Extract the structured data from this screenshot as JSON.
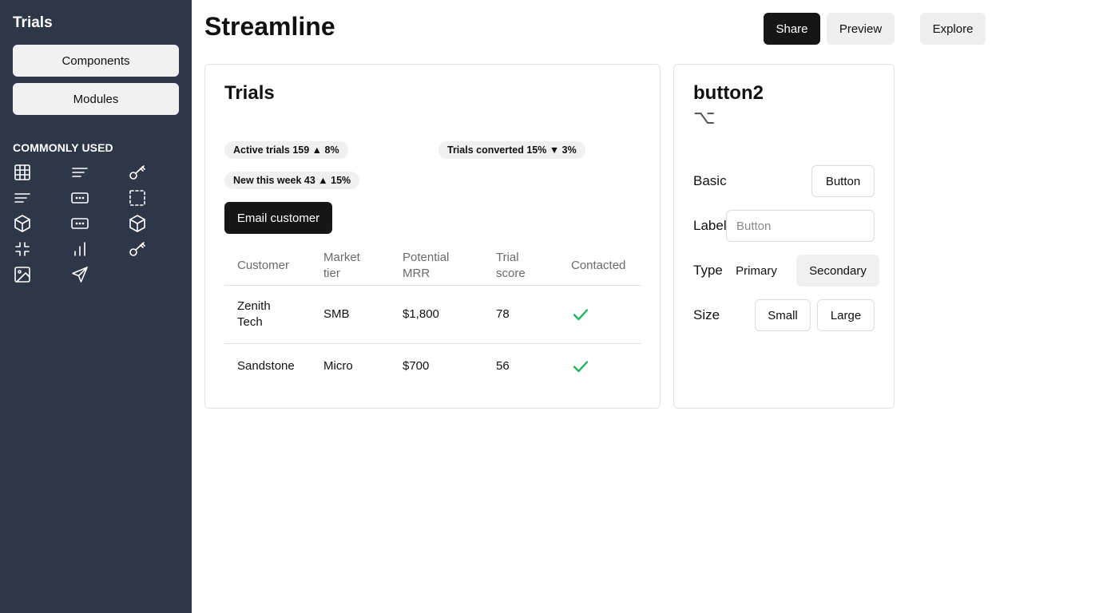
{
  "sidebar": {
    "title": "Trials",
    "buttons": [
      "Components",
      "Modules"
    ],
    "section_title": "COMMONLY USED",
    "icons": [
      "table-icon",
      "text-align-left-icon",
      "key-icon",
      "text-align-left-icon",
      "input-field-icon",
      "selection-box-icon",
      "cube-icon",
      "input-field-icon",
      "cube-icon",
      "minimize-icon",
      "bar-chart-icon",
      "key-icon",
      "image-icon",
      "send-icon"
    ]
  },
  "header": {
    "title": "Streamline",
    "share_label": "Share",
    "preview_label": "Preview",
    "explore_label": "Explore"
  },
  "trials_card": {
    "title": "Trials",
    "stats": [
      "Active trials 159 ▲ 8%",
      "Trials converted 15% ▼ 3%",
      "New this week 43 ▲ 15%"
    ],
    "email_button": "Email customer",
    "columns": [
      [
        "Customer"
      ],
      [
        "Market",
        "tier"
      ],
      [
        "Potential",
        "MRR"
      ],
      [
        "Trial",
        "score"
      ],
      [
        "Contacted"
      ]
    ],
    "rows": [
      {
        "customer": [
          "Zenith",
          "Tech"
        ],
        "tier": "SMB",
        "mrr": "$1,800",
        "score": "78",
        "contacted": true
      },
      {
        "customer": [
          "Sandstone"
        ],
        "tier": "Micro",
        "mrr": "$700",
        "score": "56",
        "contacted": true
      }
    ]
  },
  "inspector": {
    "title": "button2",
    "glyph": "⌥",
    "basic_label": "Basic",
    "basic_button": "Button",
    "label_label": "Label",
    "label_placeholder": "Button",
    "type_label": "Type",
    "type_options": [
      "Primary",
      "Secondary"
    ],
    "type_selected": "Secondary",
    "size_label": "Size",
    "size_options": [
      "Small",
      "Large"
    ]
  },
  "colors": {
    "sidebar_bg": "#2d3748",
    "primary_button": "#161616",
    "check_green": "#22b35e"
  }
}
